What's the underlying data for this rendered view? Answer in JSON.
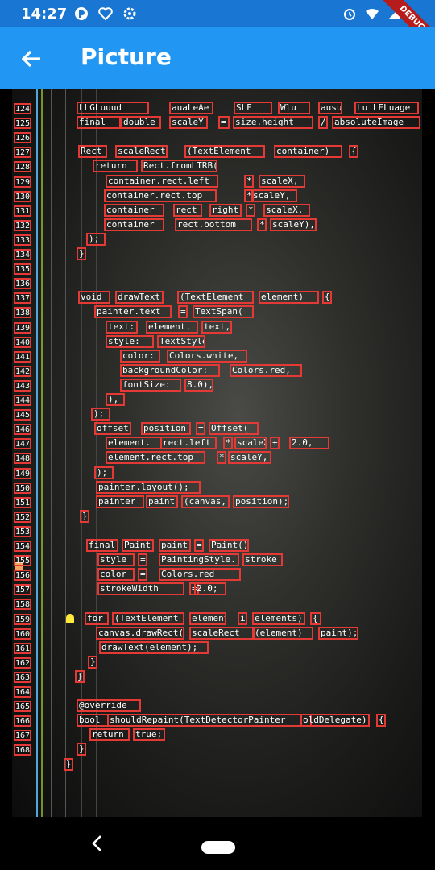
{
  "status_bar": {
    "time": "14:27",
    "debug_label": "DEBUG"
  },
  "app_bar": {
    "title": "Picture"
  },
  "code_gutter": {
    "line_numbers": [
      "124",
      "125",
      "126",
      "127",
      "128",
      "129",
      "130",
      "131",
      "132",
      "133",
      "134",
      "135",
      "136",
      "137",
      "138",
      "139",
      "140",
      "141",
      "142",
      "143",
      "144",
      "145",
      "146",
      "147",
      "148",
      "149",
      "150",
      "151",
      "152",
      "153",
      "154",
      "155",
      "156",
      "157",
      "158",
      "159",
      "160",
      "161",
      "162",
      "163",
      "164",
      "165",
      "166",
      "167",
      "168"
    ]
  },
  "detected_text": [
    "LLGLuuud",
    "auaLeAe",
    "SLE",
    "Wlu",
    "ausu",
    "Lu LELuage",
    "final",
    "double",
    "scaleY",
    "=",
    "size.height",
    "/",
    "absoluteImage",
    "Rect",
    "scaleRect",
    "(TextElement",
    "container)",
    "{",
    "return",
    "Rect.fromLTRB(",
    "container.rect.left",
    "*",
    "scaleX,",
    "container.rect.top",
    "*",
    "scaleY,",
    "container",
    "rect",
    "right",
    "*",
    "scaleX,",
    "container",
    "rect.bottom",
    "*",
    "scaleY),",
    ");",
    "}",
    "void",
    "drawText",
    "(TextElement",
    "element)",
    "{",
    "painter.text",
    "=",
    "TextSpan(",
    "text:",
    "element.",
    "text,",
    "style:",
    "TextStyle(",
    "color:",
    "Colors.white,",
    "backgroundColor:",
    "Colors.red,",
    "fontSize:",
    "8.0),",
    "),",
    ");",
    "offset",
    "position",
    "=",
    "Offset(",
    "element.",
    "rect.left",
    "*",
    "scaleX",
    "+",
    "2.0,",
    "element.rect.top",
    "*",
    "scaleY,",
    ");",
    "painter.layout();",
    "painter",
    "paint",
    "(canvas,",
    "position);",
    "}",
    "final",
    "Paint",
    "paint",
    "=",
    "Paint()",
    "style",
    "=",
    "PaintingStyle.",
    "stroke",
    "color",
    "=",
    "Colors.red",
    "strokeWidth",
    "=",
    "2.0;",
    "for",
    "(TextElement",
    "element",
    "in",
    "elements)",
    "{",
    "canvas.drawRect(",
    "scaleRect",
    "(element)",
    "paint);",
    "drawText(element);",
    "}",
    "}",
    "@override",
    "bool",
    "shouldRepaint(TextDetectorPainter",
    "oldDelegate)",
    "{",
    "return",
    "true;",
    "}",
    "}"
  ]
}
